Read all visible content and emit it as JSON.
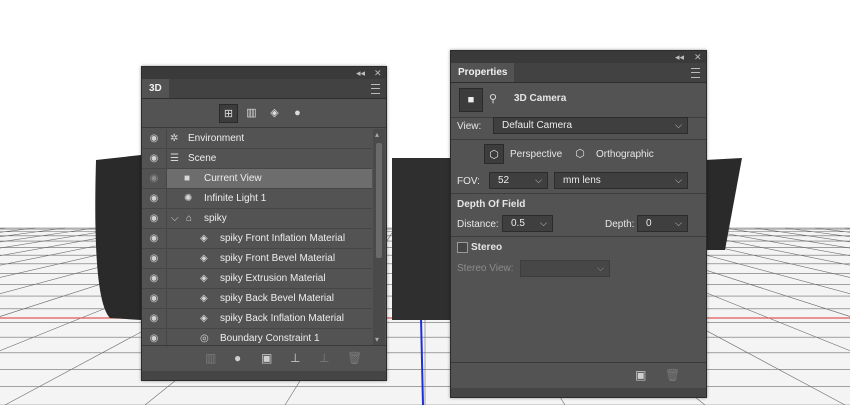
{
  "panel_3d": {
    "tab": "3D",
    "controls": {
      "collapse": "◂◂",
      "close": "✕"
    },
    "filters": [
      {
        "icon": "scene-filter-icon",
        "glyph": "⊞"
      },
      {
        "icon": "mesh-filter-icon",
        "glyph": "▥"
      },
      {
        "icon": "material-filter-icon",
        "glyph": "◈"
      },
      {
        "icon": "light-filter-icon",
        "glyph": "●"
      }
    ],
    "layers": [
      {
        "label": "Environment",
        "icon": "environment-icon",
        "glyph": "✲"
      },
      {
        "label": "Scene",
        "icon": "scene-icon",
        "glyph": "☰"
      },
      {
        "label": "Current View",
        "icon": "camera-icon",
        "glyph": "■"
      },
      {
        "label": "Infinite Light 1",
        "icon": "infinite-light-icon",
        "glyph": "✺"
      },
      {
        "label": "spiky",
        "icon": "mesh-icon",
        "glyph": "⌂",
        "expander": "⌵"
      },
      {
        "label": "spiky Front Inflation Material",
        "icon": "material-icon",
        "glyph": "◈"
      },
      {
        "label": "spiky Front Bevel Material",
        "icon": "material-icon",
        "glyph": "◈"
      },
      {
        "label": "spiky Extrusion Material",
        "icon": "material-icon",
        "glyph": "◈"
      },
      {
        "label": "spiky Back Bevel Material",
        "icon": "material-icon",
        "glyph": "◈"
      },
      {
        "label": "spiky Back Inflation Material",
        "icon": "material-icon",
        "glyph": "◈"
      },
      {
        "label": "Boundary Constraint 1",
        "icon": "constraint-icon",
        "glyph": "◎"
      }
    ],
    "eye_glyph": "◉",
    "bottom_icons": [
      {
        "name": "mesh-add-icon",
        "glyph": "▥"
      },
      {
        "name": "light-add-icon",
        "glyph": "●"
      },
      {
        "name": "render-icon",
        "glyph": "▣"
      },
      {
        "name": "drop-to-ground-icon",
        "glyph": "⊥"
      },
      {
        "name": "constraint-add-icon",
        "glyph": "⊥"
      },
      {
        "name": "delete-icon",
        "glyph": "🗑"
      }
    ]
  },
  "panel_properties": {
    "tab": "Properties",
    "controls": {
      "collapse": "◂◂",
      "close": "✕"
    },
    "header": {
      "title": "3D Camera"
    },
    "view": {
      "label": "View:",
      "value": "Default Camera"
    },
    "projection": {
      "perspective": "Perspective",
      "orthographic": "Orthographic"
    },
    "fov": {
      "label": "FOV:",
      "value": "52",
      "unit": "mm lens"
    },
    "depth_of_field": {
      "title": "Depth Of Field",
      "distance_label": "Distance:",
      "distance_value": "0.5",
      "depth_label": "Depth:",
      "depth_value": "0"
    },
    "stereo": {
      "label": "Stereo",
      "view_label": "Stereo View:"
    }
  },
  "colors": {
    "panel": "#535353",
    "highlight": "#6d6d6d",
    "dark": "#3c3c3c"
  }
}
